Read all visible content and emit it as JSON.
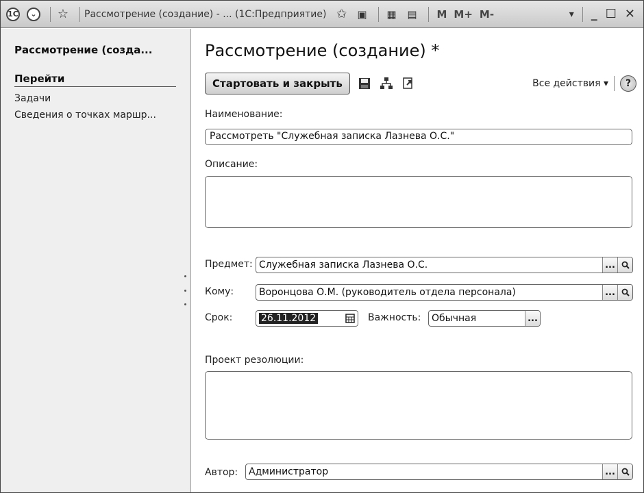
{
  "titlebar": {
    "app_icon": "1c-logo-icon",
    "title": "Рассмотрение (создание) - ...  (1С:Предприятие)",
    "m_label": "M",
    "m_plus_label": "M+",
    "m_minus_label": "M-"
  },
  "left_panel": {
    "title": "Рассмотрение (созда...",
    "goto_header": "Перейти",
    "links": [
      "Задачи",
      "Сведения о точках маршр..."
    ]
  },
  "form": {
    "title": "Рассмотрение (создание) *",
    "start_close_label": "Стартовать и закрыть",
    "all_actions_label": "Все действия ▾",
    "help_label": "?",
    "name_label": "Наименование:",
    "name_value": "Рассмотреть \"Служебная записка  Лазнева О.С.\"",
    "description_label": "Описание:",
    "subject_label": "Предмет:",
    "subject_value": "Служебная записка  Лазнева О.С.",
    "to_label": "Кому:",
    "to_value": "Воронцова О.М. (руководитель отдела персонала)",
    "due_label": "Срок:",
    "due_value": "26.11.2012",
    "importance_label": "Важность:",
    "importance_value": "Обычная",
    "resolution_label": "Проект резолюции:",
    "author_label": "Автор:",
    "author_value": "Администратор",
    "ellipsis": "..."
  }
}
